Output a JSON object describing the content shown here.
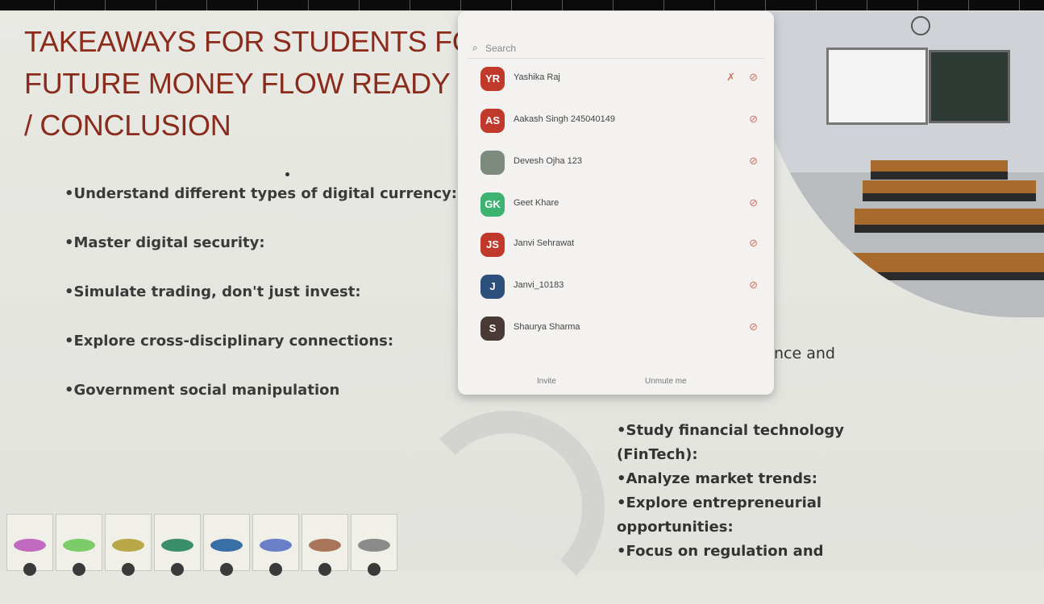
{
  "slide": {
    "title_lines": [
      "TAKEAWAYS FOR STUDENTS FO",
      "FUTURE MONEY FLOW READY",
      "/ CONCLUSION"
    ],
    "bullets": [
      "•Understand different types of digital currency:",
      "•Master digital security:",
      "•Simulate trading, don't just invest:",
      "•Explore cross-disciplinary connections:",
      "•Government social manipulation"
    ],
    "partial_text": "nce and",
    "right_bullets": [
      "•Study financial technology (FinTech):",
      "•Analyze market trends:",
      "•Explore entrepreneurial opportunities:",
      "•Focus on regulation and"
    ]
  },
  "participants_panel": {
    "search_placeholder": "Search",
    "participants": [
      {
        "initials": "YR",
        "name": "Yashika Raj",
        "color": "#c0392b"
      },
      {
        "initials": "AS",
        "name": "Aakash Singh 245040149",
        "color": "#c0392b"
      },
      {
        "initials": "",
        "name": "Devesh Ojha 123",
        "color": "#7c8b7e"
      },
      {
        "initials": "GK",
        "name": "Geet Khare",
        "color": "#3cb371"
      },
      {
        "initials": "JS",
        "name": "Janvi Sehrawat",
        "color": "#c0392b"
      },
      {
        "initials": "J",
        "name": "Janvi_10183",
        "color": "#2c4f7c"
      },
      {
        "initials": "S",
        "name": "Shaurya Sharma",
        "color": "#4a3a36"
      }
    ],
    "invite_label": "Invite",
    "unmute_label": "Unmute me"
  },
  "colors": {
    "title": "#8a2b1c",
    "panel_bg": "#f3f2f0",
    "accent": "#d2705e"
  }
}
